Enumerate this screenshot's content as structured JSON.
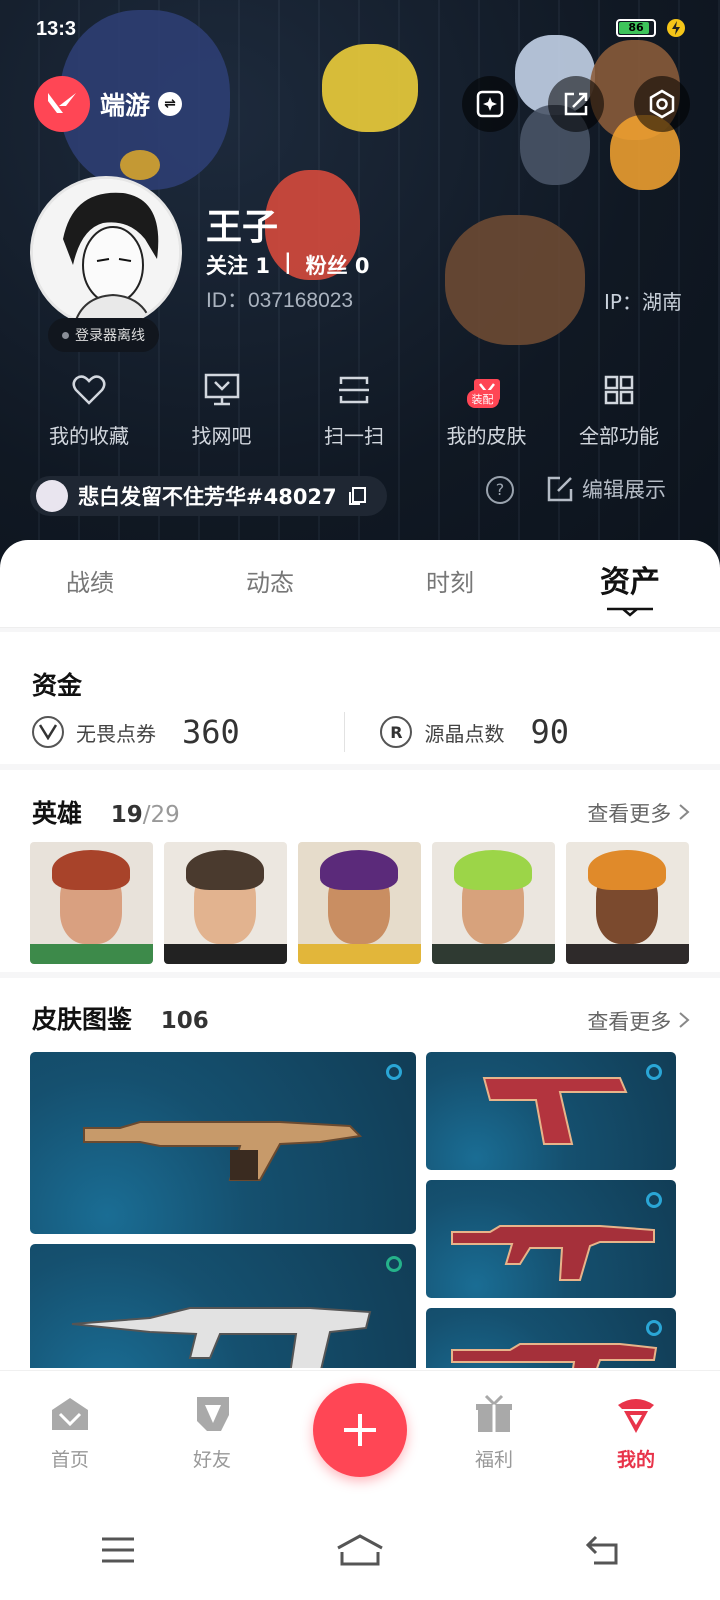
{
  "status_bar": {
    "time": "13:3",
    "battery": "86"
  },
  "app": {
    "name": "端游",
    "switch_symbol": "⇌"
  },
  "profile": {
    "name": "王子",
    "following_label": "关注",
    "following_count": "1",
    "separator": "|",
    "fans_label": "粉丝",
    "fans_count": "0",
    "id_text": "ID：037168023",
    "ip_text": "IP：湖南",
    "status_badge": "登录器离线"
  },
  "quick_actions": [
    {
      "label": "我的收藏",
      "icon": "heart-icon"
    },
    {
      "label": "找网吧",
      "icon": "monitor-icon"
    },
    {
      "label": "扫一扫",
      "icon": "scan-icon"
    },
    {
      "label": "我的皮肤",
      "icon": "skin-icon",
      "badge": "装配"
    },
    {
      "label": "全部功能",
      "icon": "grid-icon"
    }
  ],
  "game_account": {
    "name": "悲白发留不住芳华#48027"
  },
  "edit_display": {
    "label": "编辑展示",
    "help_symbol": "?"
  },
  "tabs": [
    {
      "label": "战绩",
      "active": false
    },
    {
      "label": "动态",
      "active": false
    },
    {
      "label": "时刻",
      "active": false
    },
    {
      "label": "资产",
      "active": true
    }
  ],
  "funds": {
    "title": "资金",
    "items": [
      {
        "label": "无畏点券",
        "value": "360",
        "icon": "valorant-points-icon"
      },
      {
        "label": "源晶点数",
        "value": "90",
        "icon": "radianite-icon",
        "symbol": "R"
      }
    ]
  },
  "heroes": {
    "title": "英雄",
    "owned": "19",
    "total": "/29",
    "more": "查看更多",
    "items": [
      {
        "name": "hero-1",
        "hair": "#a8432a",
        "skin": "#d9a080",
        "bg": "#e8e2da",
        "accent": "#3d8a4a"
      },
      {
        "name": "hero-2",
        "hair": "#4a3a2e",
        "skin": "#e2b38f",
        "bg": "#ece7e0",
        "accent": "#222222"
      },
      {
        "name": "hero-3",
        "hair": "#5b2a7a",
        "skin": "#c98e62",
        "bg": "#e6dccb",
        "accent": "#e2b63a"
      },
      {
        "name": "hero-4",
        "hair": "#9cd548",
        "skin": "#d7a27c",
        "bg": "#ebe6df",
        "accent": "#2f3a32"
      },
      {
        "name": "hero-5",
        "hair": "#e08a2a",
        "skin": "#7b4a2e",
        "bg": "#ece7df",
        "accent": "#2e2a2a"
      }
    ]
  },
  "skins": {
    "title": "皮肤图鉴",
    "count": "106",
    "more": "查看更多",
    "cards": [
      {
        "name": "rifle-gold",
        "ring": "blue",
        "gun_color": "#c79a6a"
      },
      {
        "name": "pistol-crimson",
        "ring": "blue",
        "gun_color": "#b3343e"
      },
      {
        "name": "smg-crimson",
        "ring": "blue",
        "gun_color": "#a5303a"
      },
      {
        "name": "rifle-silver",
        "ring": "green",
        "gun_color": "#e2e2e2"
      },
      {
        "name": "rifle-crimson",
        "ring": "blue",
        "gun_color": "#a5303a"
      }
    ]
  },
  "bottom_nav": [
    {
      "label": "首页",
      "icon": "home-icon",
      "active": false
    },
    {
      "label": "好友",
      "icon": "friends-icon",
      "active": false
    },
    {
      "label": "福利",
      "icon": "gift-icon",
      "active": false
    },
    {
      "label": "我的",
      "icon": "profile-icon",
      "active": true
    }
  ],
  "colors": {
    "accent": "#ff4655",
    "active_nav": "#e8344a",
    "header_bg": "#101823"
  }
}
